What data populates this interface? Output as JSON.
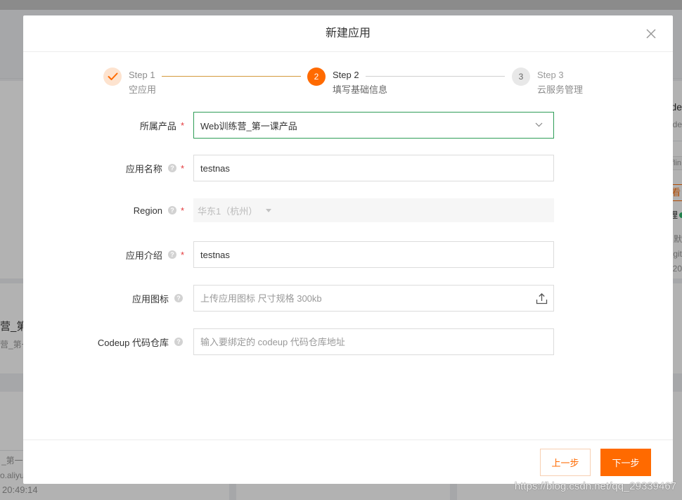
{
  "modal": {
    "title": "新建应用"
  },
  "steps": [
    {
      "title": "Step 1",
      "description": "空应用",
      "done": true,
      "active": false
    },
    {
      "title": "Step 2",
      "description": "填写基础信息",
      "number": "2",
      "done": false,
      "active": true
    },
    {
      "title": "Step 3",
      "description": "云服务管理",
      "number": "3",
      "done": false,
      "active": false
    }
  ],
  "form": {
    "product": {
      "label": "所属产品",
      "required": true,
      "help": false,
      "value": "Web训练营_第一课产品"
    },
    "app_name": {
      "label": "应用名称",
      "required": true,
      "help": true,
      "value": "testnas"
    },
    "region": {
      "label": "Region",
      "required": true,
      "help": true,
      "value": "华东1（杭州）",
      "disabled": true
    },
    "app_description": {
      "label": "应用介绍",
      "required": true,
      "help": true,
      "value": "testnas"
    },
    "app_icon": {
      "label": "应用图标",
      "required": false,
      "help": true,
      "placeholder": "上传应用图标 尺寸规格 300kb"
    },
    "codeup_repo": {
      "label": "Codeup 代码仓库",
      "required": false,
      "help": true,
      "placeholder": "输入要绑定的 codeup 代码仓库地址"
    }
  },
  "marks": {
    "required": "*",
    "help": "?"
  },
  "footer": {
    "prev_label": "上一步",
    "next_label": "下一步"
  },
  "background": {
    "left_card_title": "营_第",
    "left_card_subtitle": "营_第一",
    "left_card2_line1": "_第一",
    "left_card2_line2": "o.aliyu",
    "left_card2_time": "20:49:14",
    "right_card_title": "de",
    "right_card_subtitle": "de",
    "right_card_tag": "flin",
    "right_card_action": "看",
    "right_card_status": "理",
    "right_card_label": "默",
    "right_card_git": "git",
    "right_card_date": "20"
  },
  "watermark": "https://blog.csdn.net/qq_29339467",
  "icons": {
    "close": "close-icon",
    "step_done": "check-icon",
    "select_arrow": "chevron-down-icon",
    "region_arrow": "caret-down-icon",
    "upload": "upload-icon",
    "help": "help-icon"
  },
  "colors": {
    "accent": "#ff6a00",
    "accent_light": "#fde3cf",
    "step_line_done": "#d49a3c",
    "step_line_todo": "#d0d0d0",
    "focus_border": "#2e9d57",
    "required": "#e4393c",
    "input_border": "#dcdcdc",
    "disabled_bg": "#f6f6f6",
    "overlay": "rgba(0,0,0,0.3)"
  }
}
